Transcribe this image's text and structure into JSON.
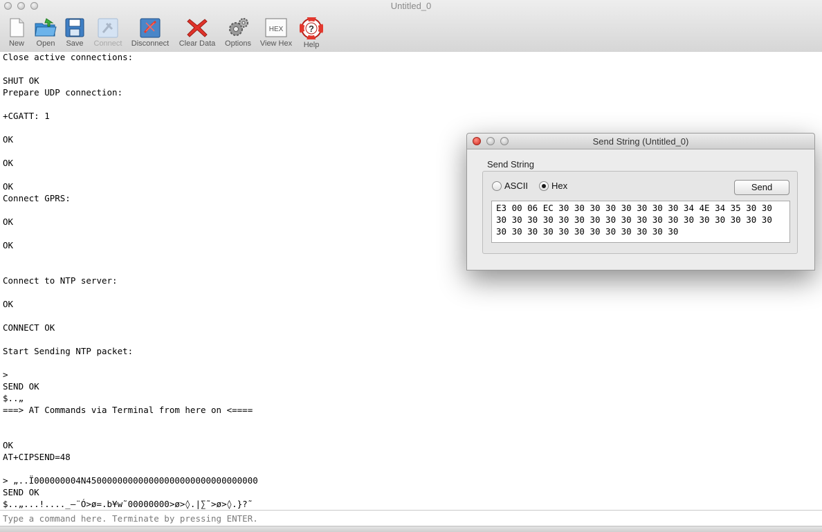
{
  "window": {
    "title": "Untitled_0"
  },
  "toolbar": {
    "items": [
      {
        "label": "New",
        "icon": "new-document-icon",
        "enabled": true
      },
      {
        "label": "Open",
        "icon": "open-folder-icon",
        "enabled": true
      },
      {
        "label": "Save",
        "icon": "floppy-disk-icon",
        "enabled": true
      },
      {
        "label": "Connect",
        "icon": "connect-plug-icon",
        "enabled": false
      },
      {
        "label": "Disconnect",
        "icon": "disconnect-plug-icon",
        "enabled": true
      },
      {
        "label": "Clear Data",
        "icon": "red-x-icon",
        "enabled": true
      },
      {
        "label": "Options",
        "icon": "gears-icon",
        "enabled": true
      },
      {
        "label": "View Hex",
        "icon": "hex-icon",
        "icon_text": "HEX",
        "enabled": true
      },
      {
        "label": "Help",
        "icon": "lifebuoy-help-icon",
        "enabled": true
      }
    ]
  },
  "terminal": {
    "lines": [
      "Close active connections:",
      "",
      "SHUT OK",
      "Prepare UDP connection:",
      "",
      "+CGATT: 1",
      "",
      "OK",
      "",
      "OK",
      "",
      "OK",
      "Connect GPRS:",
      "",
      "OK",
      "",
      "OK",
      "",
      "",
      "Connect to NTP server:",
      "",
      "OK",
      "",
      "CONNECT OK",
      "",
      "Start Sending NTP packet:",
      "",
      ">",
      "SEND OK",
      "$..„",
      "===> AT Commands via Terminal from here on <====",
      "",
      "",
      "OK",
      "AT+CIPSEND=48",
      "",
      "> „..Ï000000004N450000000000000000000000000000000",
      "SEND OK",
      "$..„...!...._–¨Ó>ø=.b¥w˜00000000>ø>◊.|∑˜>ø>◊.}?˜"
    ],
    "input_placeholder": "Type a command here. Terminate by pressing ENTER."
  },
  "dialog": {
    "title": "Send String (Untitled_0)",
    "group_label": "Send String",
    "radio_ascii_label": "ASCII",
    "radio_hex_label": "Hex",
    "selected_mode": "Hex",
    "send_button_label": "Send",
    "hex_content": "E3 00 06 EC 30 30 30 30 30 30 30 30 34 4E 34 35 30 30\n30 30 30 30 30 30 30 30 30 30 30 30 30 30 30 30 30 30\n30 30 30 30 30 30 30 30 30 30 30 30"
  }
}
